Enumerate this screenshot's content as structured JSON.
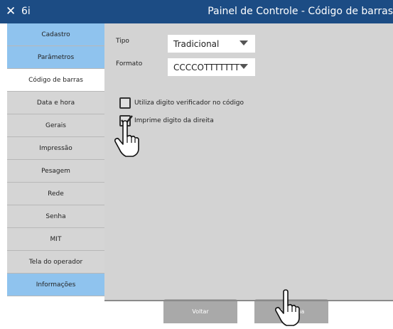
{
  "window": {
    "close_glyph": "✕",
    "app_name": "6i",
    "title": "Painel de Controle - Código de barras"
  },
  "sidebar": {
    "items": [
      {
        "label": "Cadastro",
        "style": "blue"
      },
      {
        "label": "Parâmetros",
        "style": "blue"
      },
      {
        "label": "Código de barras",
        "style": "white",
        "selected": true
      },
      {
        "label": "Data e hora",
        "style": "gray"
      },
      {
        "label": "Gerais",
        "style": "gray"
      },
      {
        "label": "Impressão",
        "style": "gray"
      },
      {
        "label": "Pesagem",
        "style": "gray"
      },
      {
        "label": "Rede",
        "style": "gray"
      },
      {
        "label": "Senha",
        "style": "gray"
      },
      {
        "label": "MIT",
        "style": "gray"
      },
      {
        "label": "Tela do operador",
        "style": "gray"
      },
      {
        "label": "Informações",
        "style": "blue"
      }
    ]
  },
  "form": {
    "tipo_label": "Tipo",
    "tipo_value": "Tradicional",
    "formato_label": "Formato",
    "formato_value": "CCCCOTTTTTTT",
    "checkbox1_label": "Utiliza digito verificador no código",
    "checkbox1_checked": false,
    "checkbox2_label": "Imprime digito da direita",
    "checkbox2_checked": true
  },
  "buttons": {
    "voltar": "Voltar",
    "confirma": "Confirma"
  },
  "colors": {
    "titlebar": "#1c4c84",
    "sidebar_blue": "#8fc3ee",
    "sidebar_gray": "#d5d5d5",
    "content_bg": "#d3d3d3",
    "button_bg": "#a9a9a9"
  },
  "icons": [
    "close-icon",
    "dropdown-arrow-icon",
    "checkmark-icon",
    "hand-pointer-icon"
  ]
}
